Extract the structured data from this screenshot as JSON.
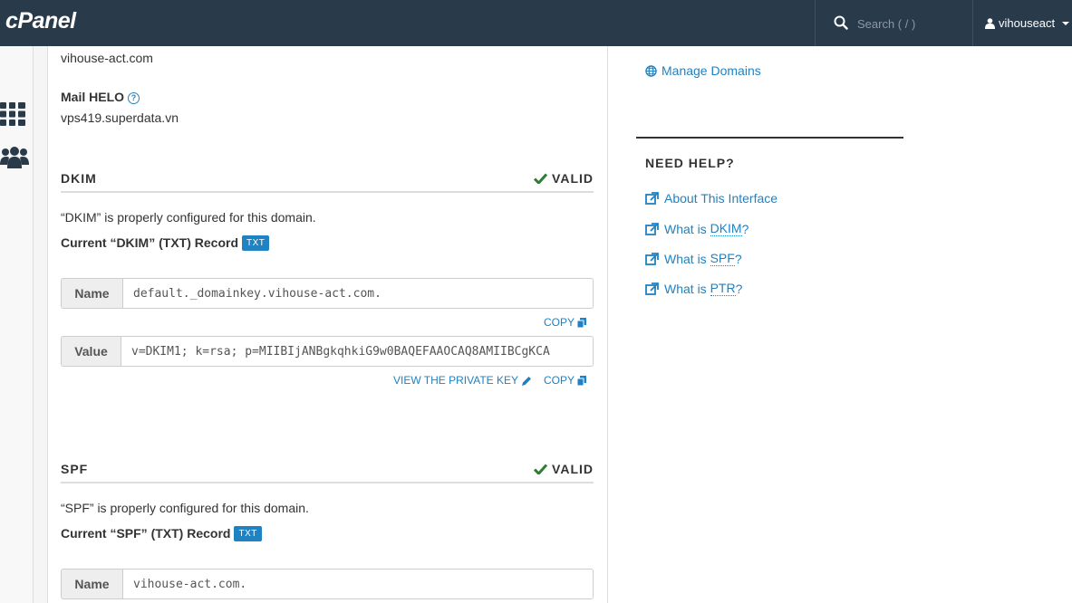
{
  "header": {
    "logo": "cPanel",
    "search_placeholder": "Search ( / )",
    "username": "vihouseact"
  },
  "main": {
    "domain_value": "vihouse-act.com",
    "mail_helo_label": "Mail HELO",
    "mail_helo_value": "vps419.superdata.vn",
    "dkim": {
      "title": "DKIM",
      "status": "VALID",
      "message": "“DKIM” is properly configured for this domain.",
      "record_label": "Current “DKIM” (TXT) Record",
      "record_badge": "TXT",
      "name_label": "Name",
      "name_value": "default._domainkey.vihouse-act.com.",
      "copy_name": "COPY",
      "value_label": "Value",
      "value_value": "v=DKIM1; k=rsa; p=MIIBIjANBgkqhkiG9w0BAQEFAAOCAQ8AMIIBCgKCA",
      "view_private_key": "VIEW THE PRIVATE KEY",
      "copy_value": "COPY"
    },
    "spf": {
      "title": "SPF",
      "status": "VALID",
      "message": "“SPF” is properly configured for this domain.",
      "record_label": "Current “SPF” (TXT) Record",
      "record_badge": "TXT",
      "name_label": "Name",
      "name_value": "vihouse-act.com."
    }
  },
  "sidebar_right": {
    "manage_domains": "Manage Domains",
    "help_title": "NEED HELP?",
    "links": [
      {
        "prefix": "About This Interface",
        "abbr": "",
        "suffix": ""
      },
      {
        "prefix": "What is ",
        "abbr": "DKIM",
        "suffix": "?"
      },
      {
        "prefix": "What is ",
        "abbr": "SPF",
        "suffix": "?"
      },
      {
        "prefix": "What is ",
        "abbr": "PTR",
        "suffix": "?"
      }
    ]
  },
  "colors": {
    "topbar": "#293a4a",
    "link": "#1e82c3",
    "valid_check": "#2e7d32"
  }
}
